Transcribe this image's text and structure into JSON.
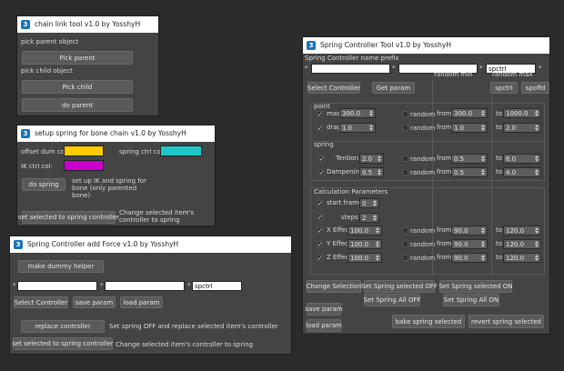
{
  "chain_link": {
    "title": "chain link tool v1.0 by YosshyH",
    "pick_parent_label": "pick parent object",
    "pick_parent_button": "Pick parent",
    "pick_child_label": "pick child object",
    "pick_child_button": "Pick child",
    "do_parent_button": "do parent"
  },
  "setup_spring": {
    "title": "setup spring for bone chain v1.0 by YosshyH",
    "offset_label": "offset dum col:",
    "offset_color": "#ffcc00",
    "spring_ctrl_label": "spring ctrl col:",
    "spring_ctrl_color": "#1ec8c8",
    "ik_label": "IK ctrl col:",
    "ik_color": "#cc00cc",
    "do_spring_button": "do spring",
    "do_spring_desc": "set up IK and spring for bone (only parented bone)",
    "set_selected_button": "set selected to spring controller",
    "set_selected_desc": "Change selected item's controller to spring"
  },
  "add_force": {
    "title": "Spring Controller add Force v1.0 by YosshyH",
    "make_dummy_button": "make dummy helper",
    "asterisk": "*",
    "prefix1": "",
    "prefix2": "",
    "prefix3": "spctrl",
    "select_controller_button": "Select Controller",
    "save_param_button": "save param",
    "load_param_button": "load param",
    "replace_controller_button": "replace controller",
    "replace_desc": "Set spring OFF and replace selected item's controller",
    "set_selected_button": "set selected to spring controller",
    "set_selected_desc": "Change selected item's controller to spring"
  },
  "tool": {
    "title": "Spring Controller Tool v1.0 by YosshyH",
    "prefix_label": "Spring Controller name prefix",
    "asterisk": "*",
    "prefix1": "",
    "prefix2": "",
    "prefix3": "spctrl",
    "select_controller_button": "Select Controller",
    "get_param_button": "Get param",
    "random_min_header": "random min",
    "random_max_header": "random max",
    "spctrl_button": "spctrl",
    "spoffd_button": "spoffd",
    "point_group": "point",
    "mass_label": "mass",
    "mass_value": "300.0",
    "drag_label": "drag",
    "drag_value": "1.0",
    "random_label": "random",
    "from_label": "from",
    "to_label": "to",
    "mass_from": "300.0",
    "mass_to": "1000.0",
    "drag_from": "1.0",
    "drag_to": "2.0",
    "spring_group": "spring",
    "tention_label": "Tention",
    "tention_value": "2.0",
    "dampening_label": "Dampening",
    "dampening_value": "0.5",
    "tention_from": "0.5",
    "tention_to": "6.0",
    "dampening_from": "0.5",
    "dampening_to": "4.0",
    "calc_group": "Calculation Parameters",
    "start_frame_label": "start frame",
    "start_frame_value": "0",
    "steps_label": "steps",
    "steps_value": "2",
    "x_effect_label": "X Effect",
    "x_effect_value": "100.0",
    "y_effect_label": "Y Effect",
    "y_effect_value": "100.0",
    "z_effect_label": "Z Effect",
    "z_effect_value": "100.0",
    "x_from": "90.0",
    "x_to": "120.0",
    "y_from": "90.0",
    "y_to": "120.0",
    "z_from": "90.0",
    "z_to": "120.0",
    "change_selection_button": "Change Selection",
    "set_spring_selected_off_button": "Set Spring selected OFF",
    "set_spring_selected_on_button": "Set Spring selected ON",
    "set_spring_all_off_button": "Set Spring All OFF",
    "set_spring_all_on_button": "Set Spring All ON",
    "save_param_button": "save param",
    "load_param_button": "load param",
    "bake_button": "bake spring selected",
    "revert_button": "revert spring selected"
  }
}
